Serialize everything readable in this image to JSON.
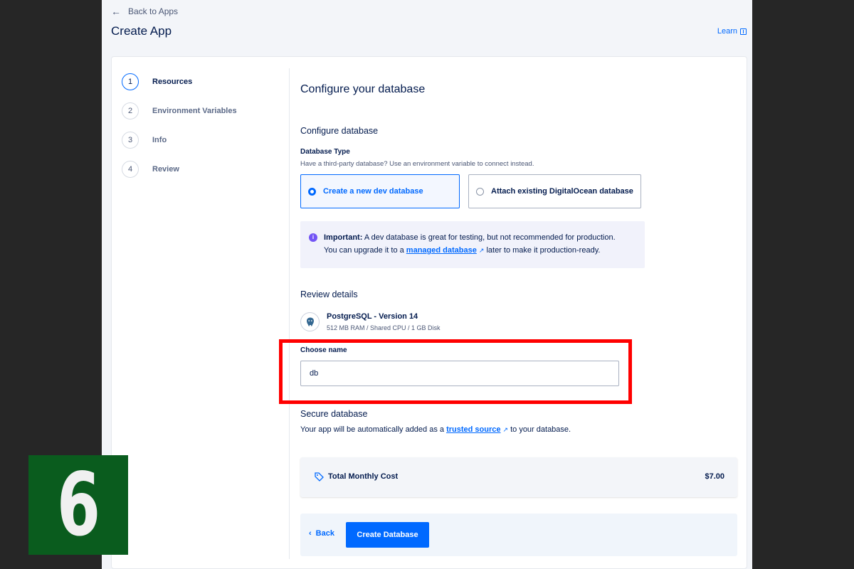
{
  "header": {
    "back_label": "Back to Apps",
    "title": "Create App",
    "learn_label": "Learn"
  },
  "steps": [
    {
      "num": "1",
      "label": "Resources",
      "active": true
    },
    {
      "num": "2",
      "label": "Environment Variables",
      "active": false
    },
    {
      "num": "3",
      "label": "Info",
      "active": false
    },
    {
      "num": "4",
      "label": "Review",
      "active": false
    }
  ],
  "main": {
    "title": "Configure your database",
    "section_title": "Configure database",
    "db_type_label": "Database Type",
    "db_type_help": "Have a third-party database? Use an environment variable to connect instead.",
    "options": [
      {
        "label": "Create a new dev database",
        "selected": true
      },
      {
        "label": "Attach existing DigitalOcean database",
        "selected": false
      }
    ],
    "notice": {
      "strong": "Important:",
      "text1": " A dev database is great for testing, but not recommended for production.",
      "text2_pre": "You can upgrade it to a ",
      "link": "managed database",
      "text2_post": " later to make it production-ready."
    },
    "review_title": "Review details",
    "db_name": "PostgreSQL - Version 14",
    "db_spec": "512 MB RAM / Shared CPU / 1 GB Disk",
    "name_label": "Choose name",
    "name_value": "db",
    "secure_title": "Secure database",
    "secure_pre": "Your app will be automatically added as a ",
    "secure_link": "trusted source",
    "secure_post": " to your database.",
    "cost_label": "Total Monthly Cost",
    "cost_value": "$7.00",
    "back_btn": "Back",
    "create_btn": "Create Database"
  },
  "overlay": {
    "step_badge": "6",
    "highlight_color": "#ff0000",
    "badge_color": "#0a5c1e"
  },
  "colors": {
    "accent": "#0069ff",
    "text": "#031b4e",
    "info": "#7355f5"
  }
}
